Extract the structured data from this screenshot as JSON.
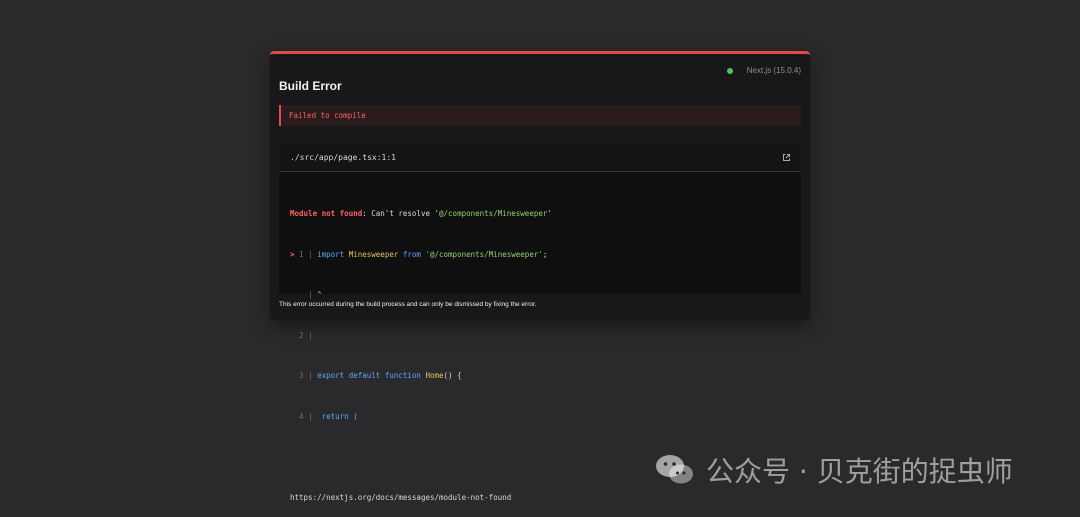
{
  "dialog": {
    "title": "Build Error",
    "version": "Next.js (15.0.4)",
    "status_color": "#4cc35c",
    "accent_color": "#e5484d",
    "error_banner": "Failed to compile",
    "file_path": "./src/app/page.tsx:1:1",
    "external_icon": "external-link-icon",
    "code": {
      "line1_prefix": "Module not found",
      "line1_rest": ": Can't resolve '",
      "line1_module": "@/components/Minesweeper",
      "line1_suffix": "'",
      "line2_marker": ">",
      "line2_num": "1",
      "line2_sep": "|",
      "line2_import": "import",
      "line2_name": "Minesweeper",
      "line2_from": "from",
      "line2_string": "'@/components/Minesweeper'",
      "line2_semicolon": ";",
      "line3_sep": "|",
      "line3_caret": "^",
      "line4_num": "2",
      "line4_sep": "|",
      "line5_num": "3",
      "line5_sep": "|",
      "line5_export": "export default function",
      "line5_fn": "Home",
      "line5_rest": "() {",
      "line6_num": "4",
      "line6_sep": "|",
      "line6_return": "  return (",
      "docs_url": "https://nextjs.org/docs/messages/module-not-found"
    },
    "footer": "This error occurred during the build process and can only be dismissed by fixing the error."
  },
  "watermark": {
    "icon": "wechat-icon",
    "text": "公众号 · 贝克街的捉虫师"
  }
}
